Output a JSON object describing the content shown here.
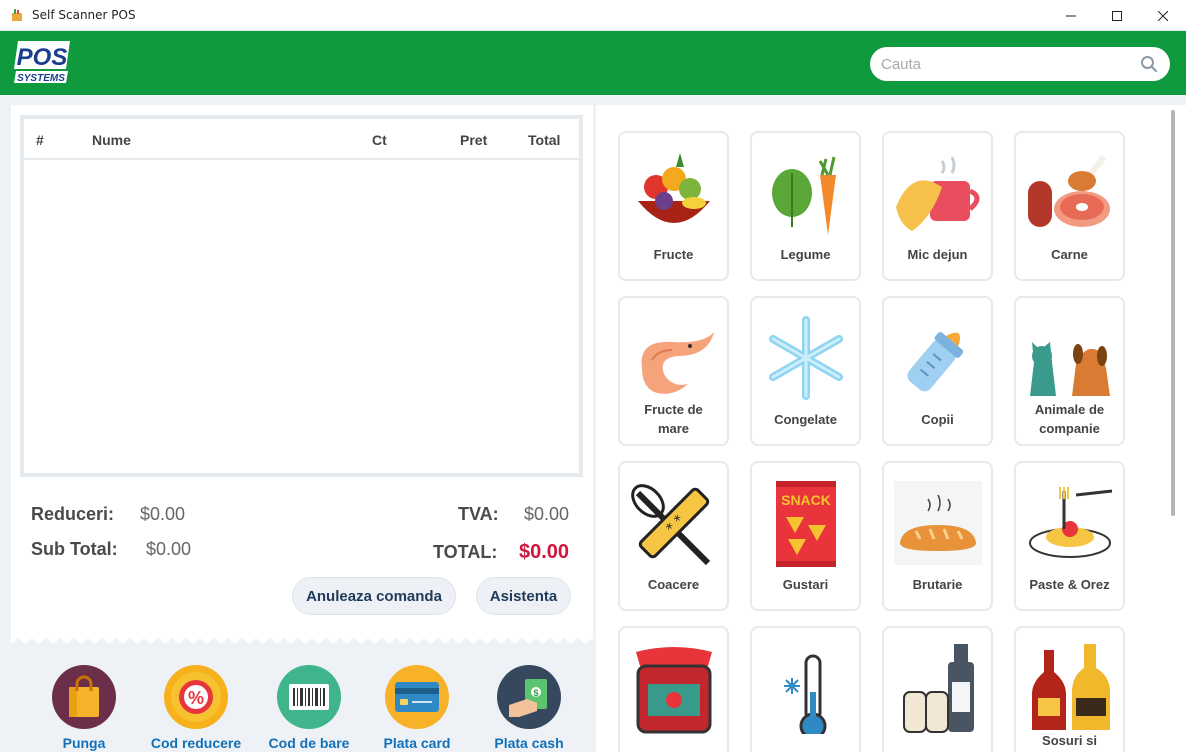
{
  "window": {
    "title": "Self Scanner POS"
  },
  "header": {
    "search_placeholder": "Cauta"
  },
  "table": {
    "columns": [
      "#",
      "Nume",
      "Ct",
      "Pret",
      "Total"
    ]
  },
  "totals": {
    "discount_label": "Reduceri:",
    "discount_value": "$0.00",
    "subtotal_label": "Sub Total:",
    "subtotal_value": "$0.00",
    "tax_label": "TVA:",
    "tax_value": "$0.00",
    "total_label": "TOTAL:",
    "total_value": "$0.00"
  },
  "buttons": {
    "cancel_order": "Anuleaza comanda",
    "assistance": "Asistenta"
  },
  "actions": [
    {
      "label": "Punga",
      "icon": "shopping-bag-icon"
    },
    {
      "label": "Cod reducere",
      "icon": "discount-badge-icon"
    },
    {
      "label": "Cod de bare",
      "icon": "barcode-icon"
    },
    {
      "label": "Plata card",
      "icon": "credit-card-icon"
    },
    {
      "label": "Plata cash",
      "icon": "cash-icon"
    }
  ],
  "categories": [
    {
      "line1": "Fructe",
      "line2": "",
      "icon": "fruit-basket-icon"
    },
    {
      "line1": "Legume",
      "line2": "",
      "icon": "vegetables-icon"
    },
    {
      "line1": "Mic dejun",
      "line2": "",
      "icon": "breakfast-icon"
    },
    {
      "line1": "Carne",
      "line2": "",
      "icon": "meat-icon"
    },
    {
      "line1": "Fructe de",
      "line2": "mare",
      "icon": "shrimp-icon"
    },
    {
      "line1": "Congelate",
      "line2": "",
      "icon": "snowflake-icon"
    },
    {
      "line1": "Copii",
      "line2": "",
      "icon": "baby-bottle-icon"
    },
    {
      "line1": "Animale de",
      "line2": "companie",
      "icon": "pets-icon"
    },
    {
      "line1": "Coacere",
      "line2": "",
      "icon": "baking-tools-icon"
    },
    {
      "line1": "Gustari",
      "line2": "",
      "icon": "snack-bag-icon"
    },
    {
      "line1": "Brutarie",
      "line2": "",
      "icon": "bread-icon"
    },
    {
      "line1": "Paste & Orez",
      "line2": "",
      "icon": "pasta-plate-icon"
    },
    {
      "line1": "",
      "line2": "",
      "icon": "jam-jar-icon"
    },
    {
      "line1": "",
      "line2": "",
      "icon": "thermometer-icon"
    },
    {
      "line1": "",
      "line2": "",
      "icon": "condiments-icon"
    },
    {
      "line1": "Sosuri si",
      "line2": "",
      "icon": "sauce-bottles-icon"
    }
  ],
  "snack_text": "SNACK",
  "colors": {
    "header_green": "#0f9a3d",
    "link_blue": "#1170b8",
    "total_red": "#d0163e"
  }
}
